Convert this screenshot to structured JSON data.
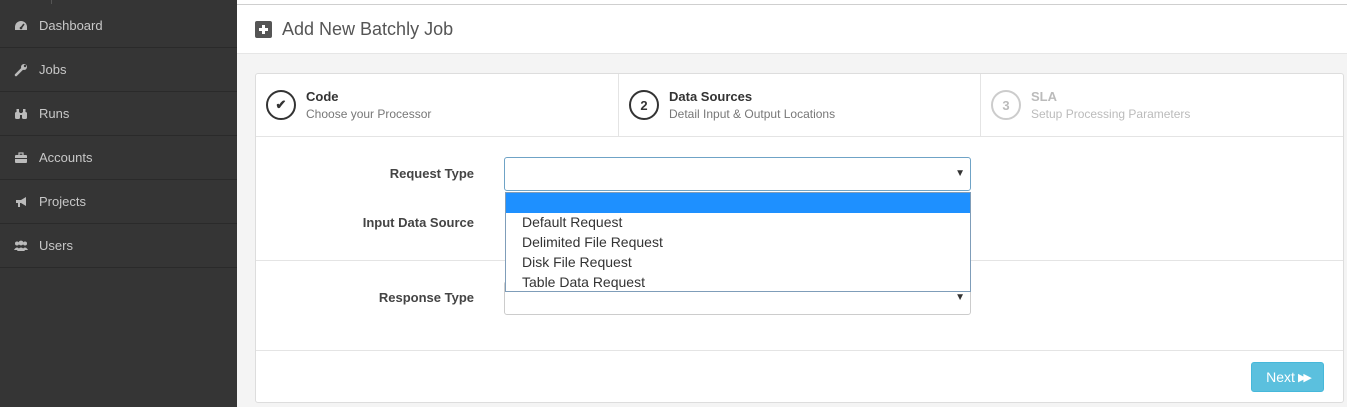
{
  "sidebar": {
    "items": [
      {
        "label": "Dashboard",
        "icon": "dashboard-icon"
      },
      {
        "label": "Jobs",
        "icon": "wrench-icon"
      },
      {
        "label": "Runs",
        "icon": "binoculars-icon"
      },
      {
        "label": "Accounts",
        "icon": "briefcase-icon"
      },
      {
        "label": "Projects",
        "icon": "bullhorn-icon"
      },
      {
        "label": "Users",
        "icon": "users-icon"
      }
    ]
  },
  "header": {
    "title": "Add New Batchly Job",
    "icon": "plus-square-icon"
  },
  "wizard": {
    "steps": [
      {
        "marker": "✔",
        "title": "Code",
        "desc": "Choose your Processor",
        "state": "complete"
      },
      {
        "marker": "2",
        "title": "Data Sources",
        "desc": "Detail Input & Output Locations",
        "state": "active"
      },
      {
        "marker": "3",
        "title": "SLA",
        "desc": "Setup Processing Parameters",
        "state": "disabled"
      }
    ]
  },
  "form": {
    "request_type_label": "Request Type",
    "input_data_source_label": "Input Data Source",
    "response_type_label": "Response Type",
    "request_type_value": "",
    "response_type_value": "",
    "request_type_options": [
      "",
      "Default Request",
      "Delimited File Request",
      "Disk File Request",
      "Table Data Request"
    ]
  },
  "actions": {
    "next_label": "Next",
    "next_icon": "double-chevron-right-icon"
  },
  "colors": {
    "sidebar_bg": "#353535",
    "next_button": "#5bc0de",
    "option_highlight": "#1e90ff"
  }
}
